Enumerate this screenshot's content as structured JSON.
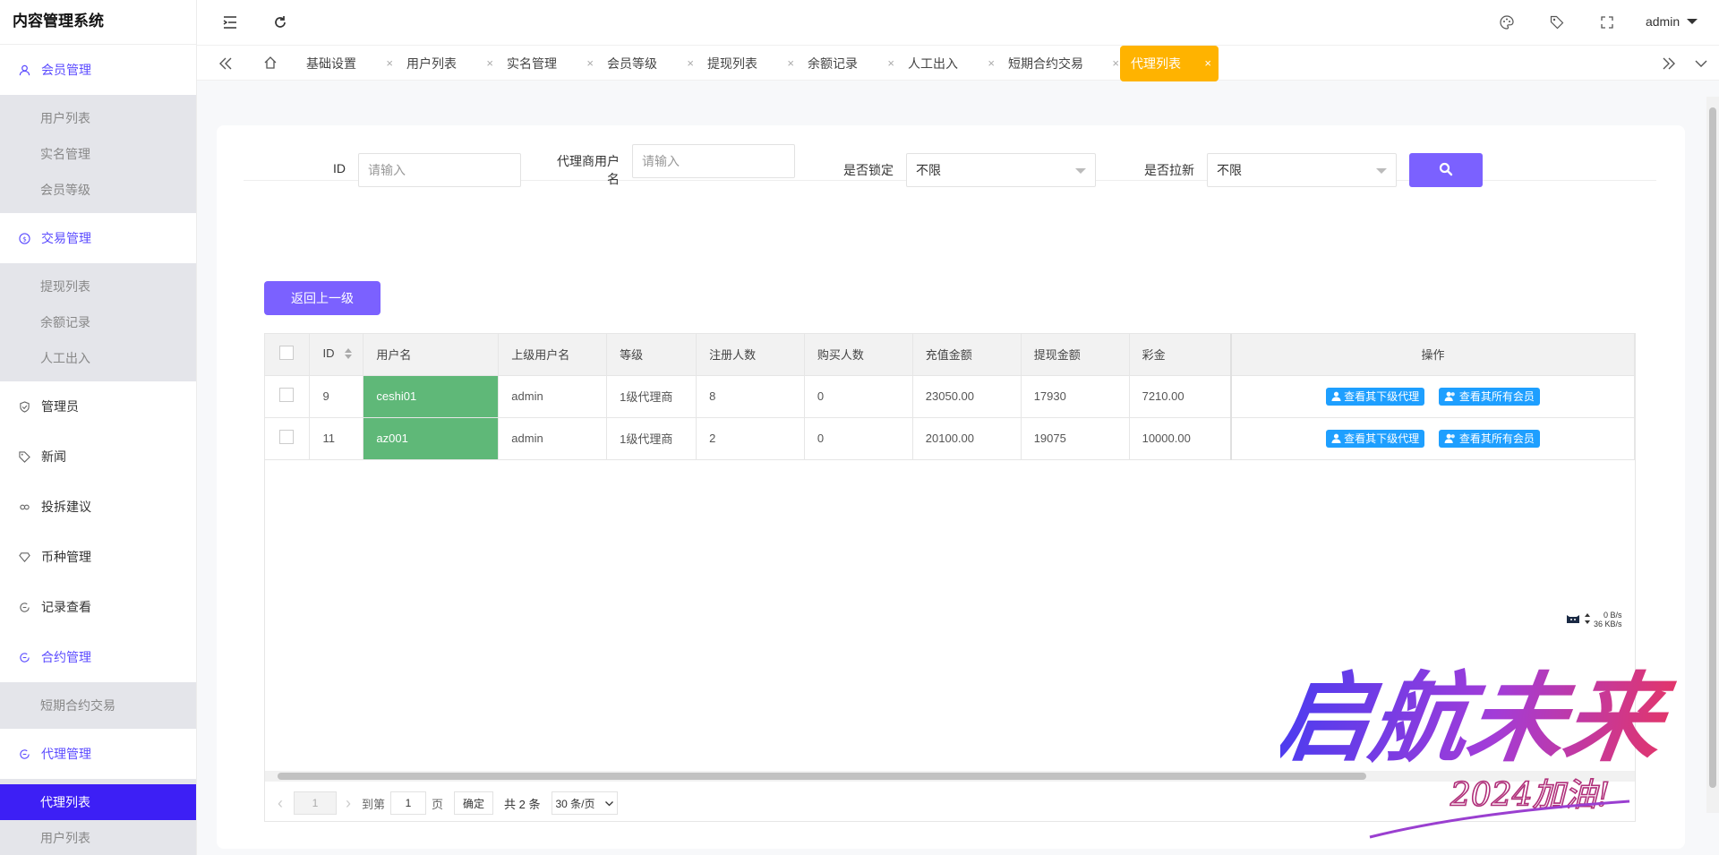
{
  "app": {
    "title": "内容管理系统"
  },
  "topbar": {
    "user": "admin"
  },
  "sidebar": {
    "groups": [
      {
        "label": "会员管理",
        "icon": "user-icon",
        "open": true,
        "items": [
          "用户列表",
          "实名管理",
          "会员等级"
        ]
      },
      {
        "label": "交易管理",
        "icon": "dollar-circle-icon",
        "open": true,
        "items": [
          "提现列表",
          "余额记录",
          "人工出入"
        ]
      },
      {
        "label": "管理员",
        "icon": "shield-icon"
      },
      {
        "label": "新闻",
        "icon": "tag-icon"
      },
      {
        "label": "投拆建议",
        "icon": "link-icon"
      },
      {
        "label": "币种管理",
        "icon": "diamond-icon"
      },
      {
        "label": "记录查看",
        "icon": "circle-arrow-icon"
      },
      {
        "label": "合约管理",
        "icon": "circle-arrow-icon",
        "open": true,
        "items": [
          "短期合约交易"
        ]
      },
      {
        "label": "代理管理",
        "icon": "circle-arrow-icon",
        "open": true,
        "items": [
          "代理列表",
          "用户列表"
        ],
        "active_item": "代理列表"
      }
    ]
  },
  "tabs": {
    "items": [
      "基础设置",
      "用户列表",
      "实名管理",
      "会员等级",
      "提现列表",
      "余额记录",
      "人工出入",
      "短期合约交易",
      "代理列表"
    ],
    "active": "代理列表",
    "close_glyph": "×"
  },
  "filters": {
    "id_label": "ID",
    "id_placeholder": "请输入",
    "agent_label_line1": "代理商用户",
    "agent_label_line2": "名",
    "agent_placeholder": "请输入",
    "locked_label": "是否锁定",
    "locked_value": "不限",
    "pull_label": "是否拉新",
    "pull_value": "不限"
  },
  "back_button": "返回上一级",
  "table": {
    "columns": [
      "ID",
      "用户名",
      "上级用户名",
      "等级",
      "注册人数",
      "购买人数",
      "充值金额",
      "提现金额",
      "彩金",
      "操作"
    ],
    "rows": [
      {
        "id": "9",
        "username": "ceshi01",
        "parent": "admin",
        "level": "1级代理商",
        "registered": "8",
        "buyers": "0",
        "recharge": "23050.00",
        "withdraw": "17930",
        "bonus": "7210.00"
      },
      {
        "id": "11",
        "username": "az001",
        "parent": "admin",
        "level": "1级代理商",
        "registered": "2",
        "buyers": "0",
        "recharge": "20100.00",
        "withdraw": "19075",
        "bonus": "10000.00"
      }
    ],
    "action_sub_agents": "查看其下级代理",
    "action_all_members": "查看其所有会员"
  },
  "pager": {
    "prev": "‹",
    "next": "›",
    "current": "1",
    "goto_label": "到第",
    "goto_value": "1",
    "page_unit": "页",
    "confirm": "确定",
    "total": "共 2 条",
    "page_size": "30 条/页"
  },
  "netspeed": {
    "up": "0 B/s",
    "down": "36 KB/s"
  },
  "watermark": {
    "main": "启航未来",
    "sub": "2024加油!"
  },
  "colors": {
    "accent": "#7b61ff",
    "active_tab": "#ffb300",
    "active_menu": "#3d1ff5",
    "green_cell": "#5fb878",
    "action_blue": "#1e9fff"
  }
}
